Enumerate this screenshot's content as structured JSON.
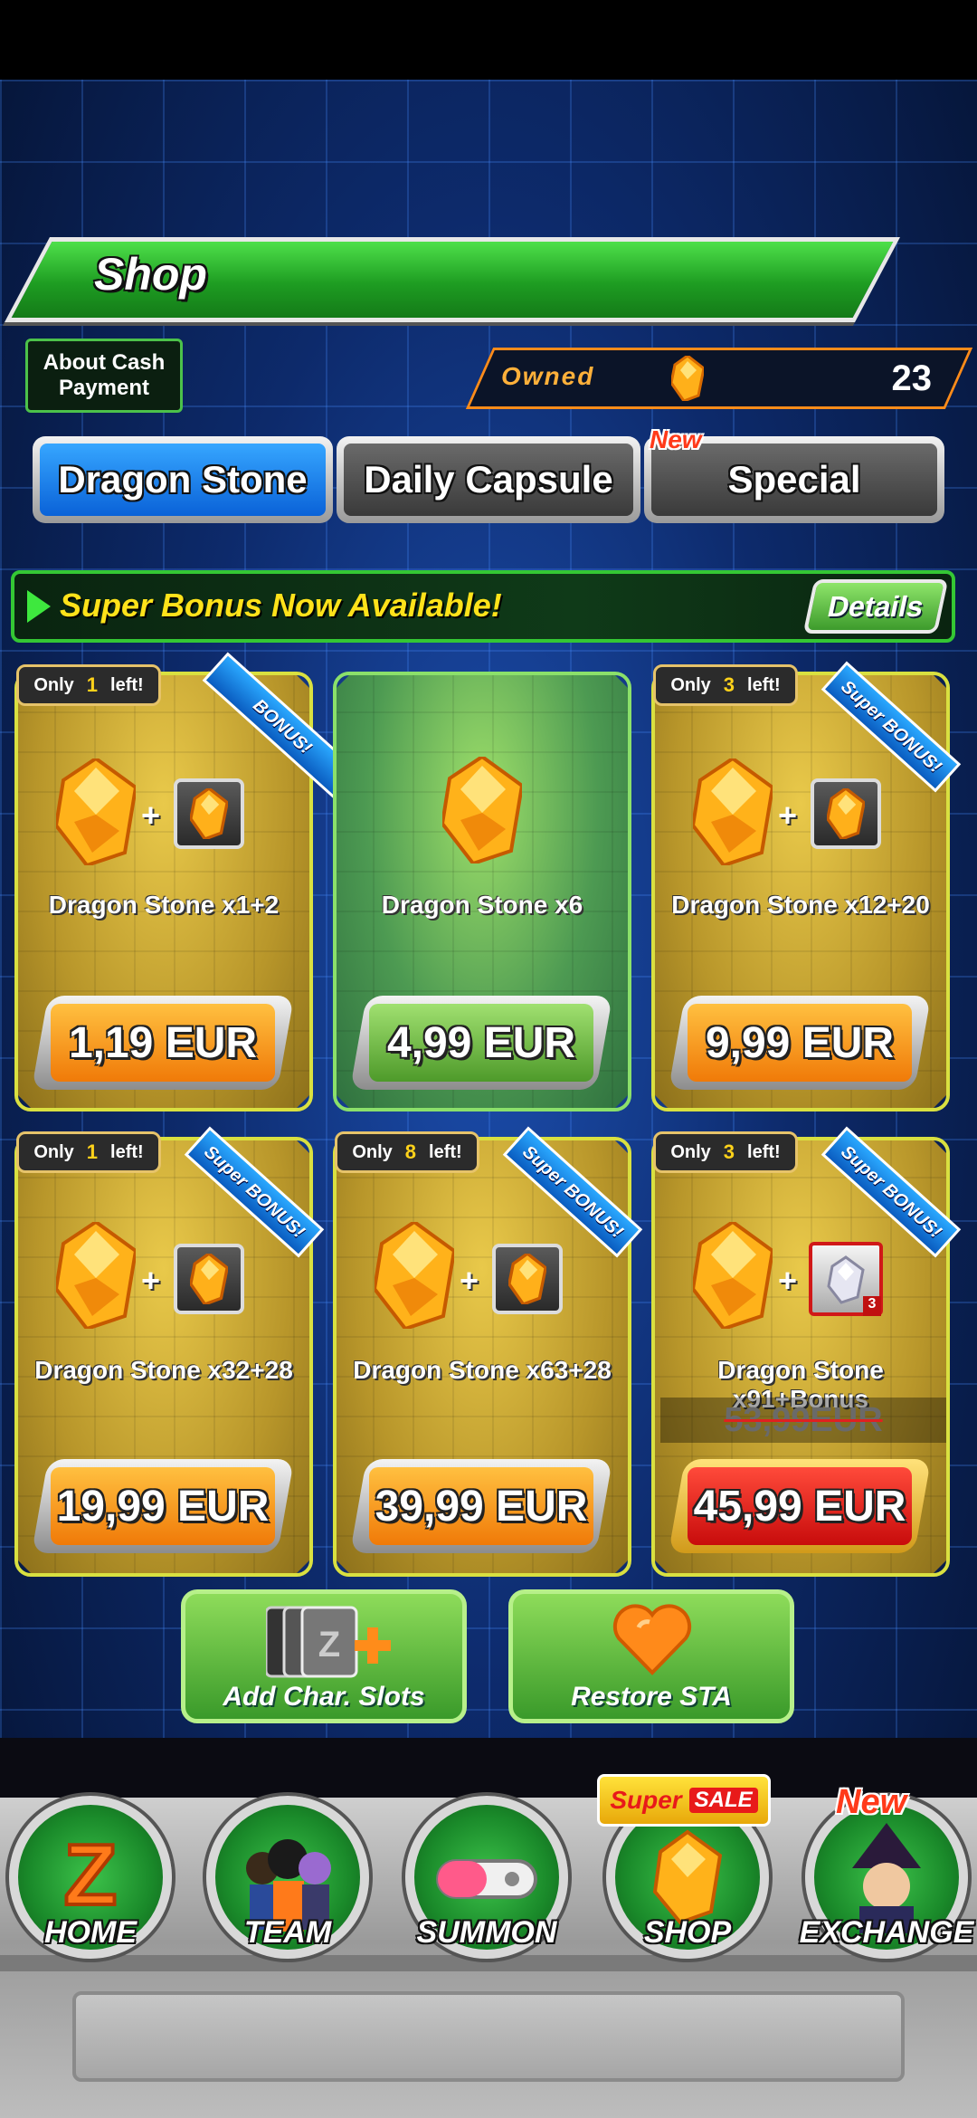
{
  "header": {
    "title": "Shop",
    "about_cash": "About Cash\nPayment",
    "owned_label": "Owned",
    "owned_value": "23"
  },
  "tabs": [
    {
      "label": "Dragon Stone",
      "active": true
    },
    {
      "label": "Daily Capsule",
      "active": false
    },
    {
      "label": "Special",
      "active": false,
      "badge": "New"
    }
  ],
  "bonus": {
    "text": "Super Bonus Now Available!",
    "details_label": "Details"
  },
  "products": [
    {
      "only_prefix": "Only",
      "remaining": "1",
      "only_suffix": "left!",
      "ribbon": "BONUS!",
      "name": "Dragon Stone x1+2",
      "price": "1,19 EUR"
    },
    {
      "name": "Dragon Stone x6",
      "price": "4,99 EUR"
    },
    {
      "only_prefix": "Only",
      "remaining": "3",
      "only_suffix": "left!",
      "ribbon": "Super BONUS!",
      "name": "Dragon Stone x12+20",
      "price": "9,99 EUR"
    },
    {
      "only_prefix": "Only",
      "remaining": "1",
      "only_suffix": "left!",
      "ribbon": "Super BONUS!",
      "name": "Dragon Stone x32+28",
      "price": "19,99 EUR"
    },
    {
      "only_prefix": "Only",
      "remaining": "8",
      "only_suffix": "left!",
      "ribbon": "Super BONUS!",
      "name": "Dragon Stone x63+28",
      "price": "39,99 EUR"
    },
    {
      "only_prefix": "Only",
      "remaining": "3",
      "only_suffix": "left!",
      "ribbon": "Super BONUS!",
      "name": "Dragon Stone x91+Bonus",
      "original_price": "53,99EUR",
      "price": "45,99 EUR",
      "bonus_card_count": "3"
    }
  ],
  "actions": {
    "add_slots_label": "Add Char. Slots",
    "restore_sta_label": "Restore STA"
  },
  "nav": {
    "items": [
      {
        "label": "HOME",
        "icon": "z-logo-icon"
      },
      {
        "label": "TEAM",
        "icon": "characters-icon"
      },
      {
        "label": "SUMMON",
        "icon": "capsule-icon"
      },
      {
        "label": "SHOP",
        "icon": "dragon-stone-icon"
      },
      {
        "label": "EXCHANGE",
        "icon": "exchange-character-icon"
      }
    ],
    "shop_badge_1": "Super",
    "shop_badge_2": "SALE",
    "exchange_badge": "New"
  },
  "colors": {
    "accent_green": "#1e9d22",
    "tab_active_blue": "#0a62d8",
    "price_orange": "#f07a08",
    "sale_red": "#c80c0c",
    "bonus_yellow": "#ffe21a"
  }
}
